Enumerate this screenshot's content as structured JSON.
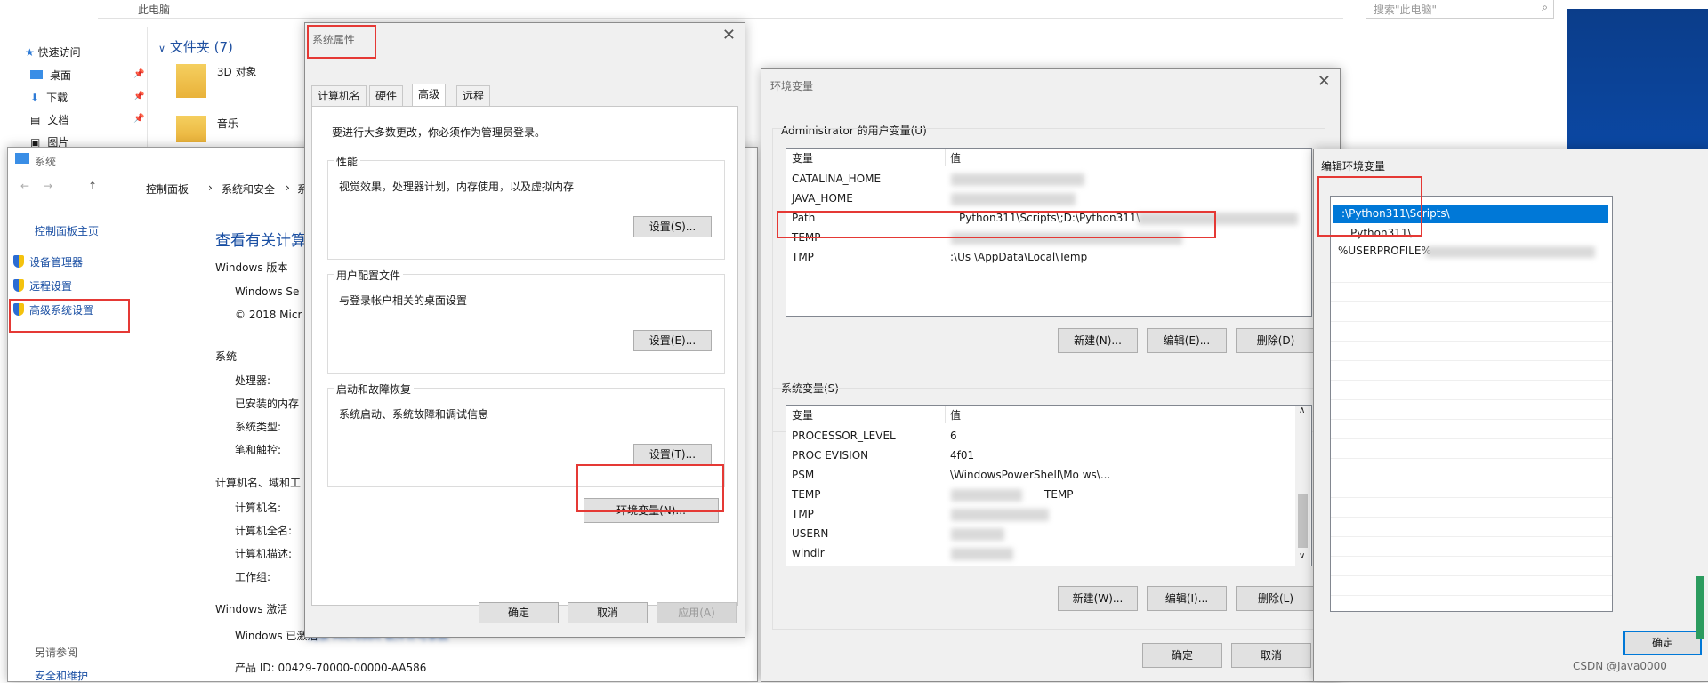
{
  "explorer": {
    "address": "此电脑",
    "search_placeholder": "搜索\"此电脑\"",
    "quick_access": "快速访问",
    "nav": [
      "桌面",
      "下载",
      "文档",
      "图片"
    ],
    "folders_header": "文件夹 (7)",
    "folders": [
      "3D 对象",
      "音乐"
    ]
  },
  "system_window": {
    "title": "系统",
    "breadcrumb": [
      "控制面板",
      "系统和安全",
      "系"
    ],
    "sidebar_home": "控制面板主页",
    "sidebar_links": [
      "设备管理器",
      "远程设置",
      "高级系统设置"
    ],
    "see_also": "另请参阅",
    "see_also_item": "安全和维护",
    "heading": "查看有关计算",
    "edition_label": "Windows 版本",
    "edition_value": "Windows Se",
    "copyright": "© 2018 Micr",
    "system_label": "系统",
    "system_rows": [
      "处理器:",
      "已安装的内存",
      "系统类型:",
      "笔和触控:"
    ],
    "computer_label": "计算机名、域和工",
    "computer_rows": [
      "计算机名:",
      "计算机全名:",
      "计算机描述:",
      "工作组:"
    ],
    "activation_label": "Windows 激活",
    "activation_value": "Windows 已激活",
    "activation_link": "阅读 Microsoft 软件许可条款",
    "product_id": "产品 ID: 00429-70000-00000-AA586"
  },
  "sysprops": {
    "title": "系统属性",
    "tabs": [
      "计算机名",
      "硬件",
      "高级",
      "远程"
    ],
    "admin_note": "要进行大多数更改，你必须作为管理员登录。",
    "perf_title": "性能",
    "perf_desc": "视觉效果，处理器计划，内存使用，以及虚拟内存",
    "perf_btn": "设置(S)...",
    "profile_title": "用户配置文件",
    "profile_desc": "与登录帐户相关的桌面设置",
    "profile_btn": "设置(E)...",
    "startup_title": "启动和故障恢复",
    "startup_desc": "系统启动、系统故障和调试信息",
    "startup_btn": "设置(T)...",
    "env_btn": "环境变量(N)...",
    "ok": "确定",
    "cancel": "取消",
    "apply": "应用(A)"
  },
  "envvars": {
    "title": "环境变量",
    "user_title": "Administrator 的用户变量(U)",
    "col_var": "变量",
    "col_val": "值",
    "user_rows": [
      {
        "name": "CATALINA_HOME",
        "value": ""
      },
      {
        "name": "JAVA_HOME",
        "value": ""
      },
      {
        "name": "Path",
        "value": "Python311\\Scripts\\;D:\\Python311\\"
      },
      {
        "name": "TEMP",
        "value": ""
      },
      {
        "name": "TMP",
        "value": ":\\Us               \\AppData\\Local\\Temp"
      }
    ],
    "user_buttons": [
      "新建(N)...",
      "编辑(E)...",
      "删除(D)"
    ],
    "sys_title": "系统变量(S)",
    "sys_rows": [
      {
        "name": "PROCESSOR_LEVEL",
        "value": "6"
      },
      {
        "name": "PROC        EVISION",
        "value": "4f01"
      },
      {
        "name": "PSM",
        "value": "               \\WindowsPowerShell\\Mo            ws\\..."
      },
      {
        "name": "TEMP",
        "value": "TEMP"
      },
      {
        "name": "TMP",
        "value": ""
      },
      {
        "name": "USERN",
        "value": ""
      },
      {
        "name": "windir",
        "value": ""
      }
    ],
    "sys_buttons": [
      "新建(W)...",
      "编辑(I)...",
      "删除(L)"
    ],
    "ok": "确定",
    "cancel": "取消"
  },
  "editvar": {
    "title": "编辑环境变量",
    "items": [
      ":\\Python311\\Scripts\\",
      "Python311\\",
      "%USERPROFILE%"
    ],
    "ok": "确定"
  },
  "watermark": "CSDN @Java0000",
  "colors": {
    "highlight": "#0078d7",
    "annotation": "#e53935"
  }
}
